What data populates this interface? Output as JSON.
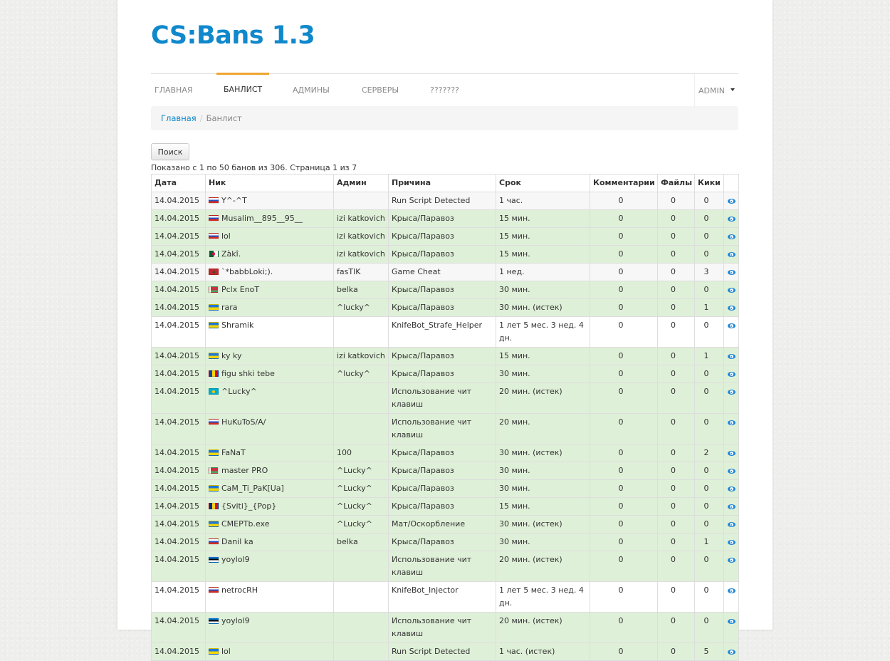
{
  "site": {
    "title": "CS:Bans 1.3"
  },
  "nav": {
    "items": [
      {
        "label": "ГЛАВНАЯ",
        "active": false
      },
      {
        "label": "БАНЛИСТ",
        "active": true
      },
      {
        "label": "АДМИНЫ",
        "active": false
      },
      {
        "label": "СЕРВЕРЫ",
        "active": false
      },
      {
        "label": "???????",
        "active": false
      }
    ],
    "user_menu": "ADMIN"
  },
  "breadcrumb": {
    "home": "Главная",
    "separator": "/",
    "current": "Банлист"
  },
  "search": {
    "button_label": "Поиск"
  },
  "summary": "Показано с 1 по 50 банов из 306. Страница 1 из 7",
  "table": {
    "headers": [
      "Дата",
      "Ник",
      "Админ",
      "Причина",
      "Срок",
      "Комментарии",
      "Файлы",
      "Кики"
    ],
    "rows": [
      {
        "date": "14.04.2015",
        "flag": "ru",
        "nick": "Y^-^T",
        "admin": "",
        "reason": "Run Script Detected",
        "term": "1 час.",
        "comments": "0",
        "files": "0",
        "kicks": "0",
        "style": "gray"
      },
      {
        "date": "14.04.2015",
        "flag": "ru",
        "nick": "Musalim__895__95__",
        "admin": "izi katkovich",
        "reason": "Крыса/Паравоз",
        "term": "15 мин.",
        "comments": "0",
        "files": "0",
        "kicks": "0",
        "style": "green"
      },
      {
        "date": "14.04.2015",
        "flag": "ru",
        "nick": "lol",
        "admin": "izi katkovich",
        "reason": "Крыса/Паравоз",
        "term": "15 мин.",
        "comments": "0",
        "files": "0",
        "kicks": "0",
        "style": "green"
      },
      {
        "date": "14.04.2015",
        "flag": "dz",
        "nick": "Zàkî.",
        "admin": "izi katkovich",
        "reason": "Крыса/Паравоз",
        "term": "15 мин.",
        "comments": "0",
        "files": "0",
        "kicks": "0",
        "style": "green"
      },
      {
        "date": "14.04.2015",
        "flag": "ma",
        "nick": "`*babbLoki;).",
        "admin": "fasTIK",
        "reason": "Game Cheat",
        "term": "1 нед.",
        "comments": "0",
        "files": "0",
        "kicks": "3",
        "style": "gray"
      },
      {
        "date": "14.04.2015",
        "flag": "by",
        "nick": "Pclx EnoT",
        "admin": "belka",
        "reason": "Крыса/Паравоз",
        "term": "30 мин.",
        "comments": "0",
        "files": "0",
        "kicks": "0",
        "style": "green"
      },
      {
        "date": "14.04.2015",
        "flag": "ua",
        "nick": "rara",
        "admin": "^lucky^",
        "reason": "Крыса/Паравоз",
        "term": "30 мин. (истек)",
        "comments": "0",
        "files": "0",
        "kicks": "1",
        "style": "green"
      },
      {
        "date": "14.04.2015",
        "flag": "ua",
        "nick": "Shramik",
        "admin": "",
        "reason": "KnifeBot_Strafe_Helper",
        "term": "1 лет 5 мес. 3 нед. 4 дн.",
        "comments": "0",
        "files": "0",
        "kicks": "0",
        "style": "white"
      },
      {
        "date": "14.04.2015",
        "flag": "ua",
        "nick": "ky ky",
        "admin": "izi katkovich",
        "reason": "Крыса/Паравоз",
        "term": "15 мин.",
        "comments": "0",
        "files": "0",
        "kicks": "1",
        "style": "green"
      },
      {
        "date": "14.04.2015",
        "flag": "md",
        "nick": "figu shki tebe",
        "admin": "^lucky^",
        "reason": "Крыса/Паравоз",
        "term": "30 мин.",
        "comments": "0",
        "files": "0",
        "kicks": "0",
        "style": "green"
      },
      {
        "date": "14.04.2015",
        "flag": "kz",
        "nick": "^Lucky^",
        "admin": "",
        "reason": "Использование чит клавиш",
        "term": "20 мин. (истек)",
        "comments": "0",
        "files": "0",
        "kicks": "0",
        "style": "green"
      },
      {
        "date": "14.04.2015",
        "flag": "ru",
        "nick": "HuKuToS/A/",
        "admin": "",
        "reason": "Использование чит клавиш",
        "term": "20 мин.",
        "comments": "0",
        "files": "0",
        "kicks": "0",
        "style": "green"
      },
      {
        "date": "14.04.2015",
        "flag": "ua",
        "nick": "FaNaT",
        "admin": "100",
        "reason": "Крыса/Паравоз",
        "term": "30 мин. (истек)",
        "comments": "0",
        "files": "0",
        "kicks": "2",
        "style": "green"
      },
      {
        "date": "14.04.2015",
        "flag": "by",
        "nick": "master PRO",
        "admin": "^Lucky^",
        "reason": "Крыса/Паравоз",
        "term": "30 мин.",
        "comments": "0",
        "files": "0",
        "kicks": "0",
        "style": "green"
      },
      {
        "date": "14.04.2015",
        "flag": "ua",
        "nick": "CaM_Ti_PaK[Ua]",
        "admin": "^Lucky^",
        "reason": "Крыса/Паравоз",
        "term": "30 мин.",
        "comments": "0",
        "files": "0",
        "kicks": "0",
        "style": "green"
      },
      {
        "date": "14.04.2015",
        "flag": "ro",
        "nick": "{Sviti}_{Pop}",
        "admin": "^Lucky^",
        "reason": "Крыса/Паравоз",
        "term": "15 мин.",
        "comments": "0",
        "files": "0",
        "kicks": "0",
        "style": "green"
      },
      {
        "date": "14.04.2015",
        "flag": "ua",
        "nick": "CMEPTb.exe",
        "admin": "^Lucky^",
        "reason": "Мат/Оскорбление",
        "term": "30 мин. (истек)",
        "comments": "0",
        "files": "0",
        "kicks": "0",
        "style": "green"
      },
      {
        "date": "14.04.2015",
        "flag": "ru",
        "nick": "Danil ka",
        "admin": "belka",
        "reason": "Крыса/Паравоз",
        "term": "30 мин.",
        "comments": "0",
        "files": "0",
        "kicks": "1",
        "style": "green"
      },
      {
        "date": "14.04.2015",
        "flag": "ee",
        "nick": "yoylol9",
        "admin": "",
        "reason": "Использование чит клавиш",
        "term": "20 мин. (истек)",
        "comments": "0",
        "files": "0",
        "kicks": "0",
        "style": "green"
      },
      {
        "date": "14.04.2015",
        "flag": "ru",
        "nick": "netrocRH",
        "admin": "",
        "reason": "KnifeBot_Injector",
        "term": "1 лет 5 мес. 3 нед. 4 дн.",
        "comments": "0",
        "files": "0",
        "kicks": "0",
        "style": "white"
      },
      {
        "date": "14.04.2015",
        "flag": "ee",
        "nick": "yoylol9",
        "admin": "",
        "reason": "Использование чит клавиш",
        "term": "20 мин. (истек)",
        "comments": "0",
        "files": "0",
        "kicks": "0",
        "style": "green"
      },
      {
        "date": "14.04.2015",
        "flag": "ua",
        "nick": "lol",
        "admin": "",
        "reason": "Run Script Detected",
        "term": "1 час. (истек)",
        "comments": "0",
        "files": "0",
        "kicks": "5",
        "style": "green"
      }
    ]
  },
  "icons": {
    "details": "eye-icon"
  },
  "colors": {
    "brand": "#0f88cc",
    "active_nav": "#f0a531",
    "row_green": "#dff0d8",
    "link": "#0f88cc"
  }
}
